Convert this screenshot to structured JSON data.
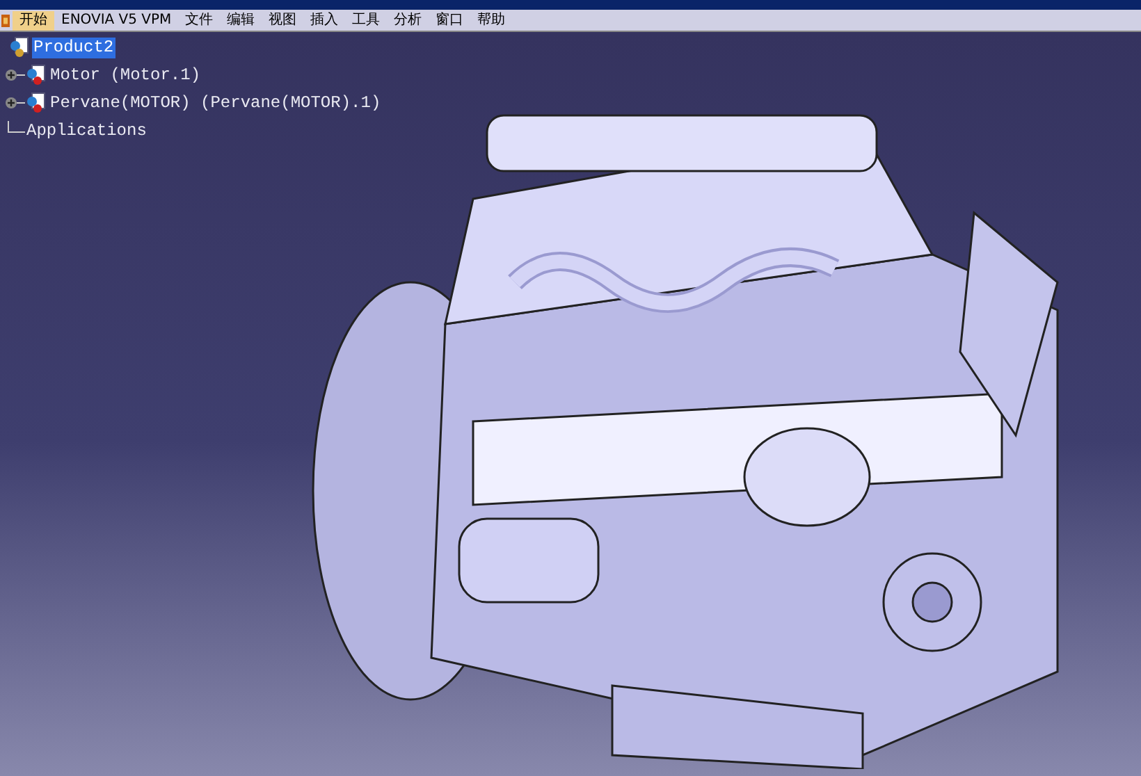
{
  "menu_bar": {
    "items": [
      {
        "label": "开始",
        "selected": true
      },
      {
        "label": "ENOVIA V5 VPM",
        "selected": false
      },
      {
        "label": "文件",
        "selected": false
      },
      {
        "label": "编辑",
        "selected": false
      },
      {
        "label": "视图",
        "selected": false
      },
      {
        "label": "插入",
        "selected": false
      },
      {
        "label": "工具",
        "selected": false
      },
      {
        "label": "分析",
        "selected": false
      },
      {
        "label": "窗口",
        "selected": false
      },
      {
        "label": "帮助",
        "selected": false
      }
    ]
  },
  "tree": {
    "root": {
      "label": "Product2",
      "kind": "product",
      "selected": true,
      "children": [
        {
          "label": "Motor (Motor.1)",
          "kind": "component",
          "collapsed": true,
          "selected": false
        },
        {
          "label": "Pervane(MOTOR) (Pervane(MOTOR).1)",
          "kind": "component",
          "collapsed": true,
          "selected": false
        },
        {
          "label": "Applications",
          "kind": "applications",
          "collapsed": false,
          "selected": false
        }
      ]
    }
  }
}
